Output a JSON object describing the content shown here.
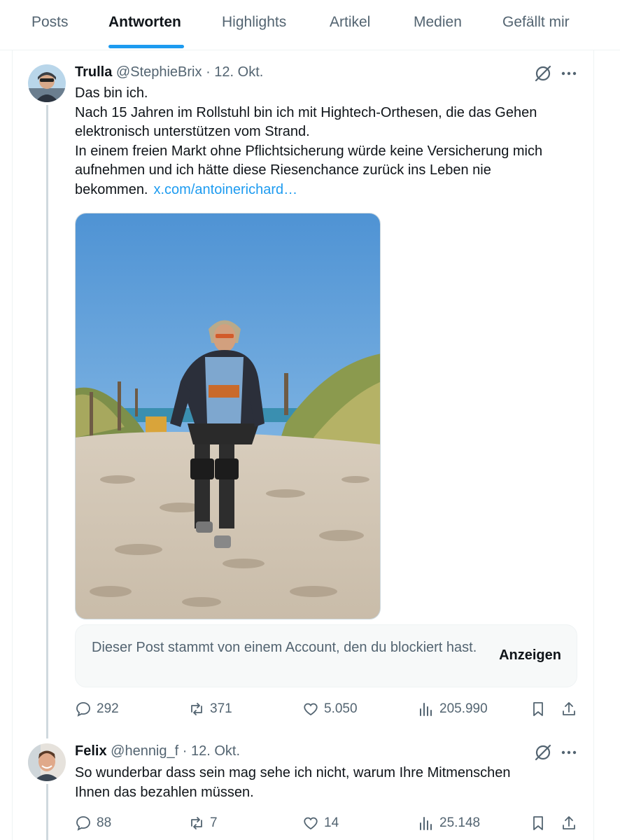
{
  "tabs": [
    {
      "label": "Posts"
    },
    {
      "label": "Antworten"
    },
    {
      "label": "Highlights"
    },
    {
      "label": "Artikel"
    },
    {
      "label": "Medien"
    },
    {
      "label": "Gefällt mir"
    }
  ],
  "active_tab": "Antworten",
  "post1": {
    "name": "Trulla",
    "handle": "@StephieBrix",
    "separator": "·",
    "date": "12. Okt.",
    "lines": [
      "Das bin ich.",
      "Nach 15 Jahren im Rollstuhl bin ich mit Hightech-Orthesen, die das Gehen",
      "elektronisch unterstützen vom Strand.",
      "In einem freien Markt ohne Pflichtsicherung würde keine Versicherung mich",
      "aufnehmen und ich hätte diese Riesenchance zurück ins Leben nie",
      "bekommen."
    ],
    "link": "x.com/antoinerichard…",
    "blocked_notice": "Dieser Post stammt von einem Account, den du blockiert hast.",
    "show_label": "Anzeigen",
    "replies": "292",
    "reposts": "371",
    "likes": "5.050",
    "views": "205.990"
  },
  "post2": {
    "name": "Felix",
    "handle": "@hennig_f",
    "separator": "·",
    "date": "12. Okt.",
    "lines": [
      "So wunderbar dass sein mag sehe ich nicht, warum Ihre Mitmenschen",
      "Ihnen das bezahlen müssen."
    ],
    "replies": "88",
    "reposts": "7",
    "likes": "14",
    "views": "25.148"
  },
  "icons": {
    "reply": "reply-icon",
    "repost": "repost-icon",
    "like": "heart-icon",
    "views": "views-icon",
    "bookmark": "bookmark-icon",
    "share": "share-icon",
    "grok": "grok-icon",
    "more": "more-icon"
  },
  "colors": {
    "accent": "#1d9bf0",
    "secondary_text": "#536471",
    "primary_text": "#0f1419"
  }
}
